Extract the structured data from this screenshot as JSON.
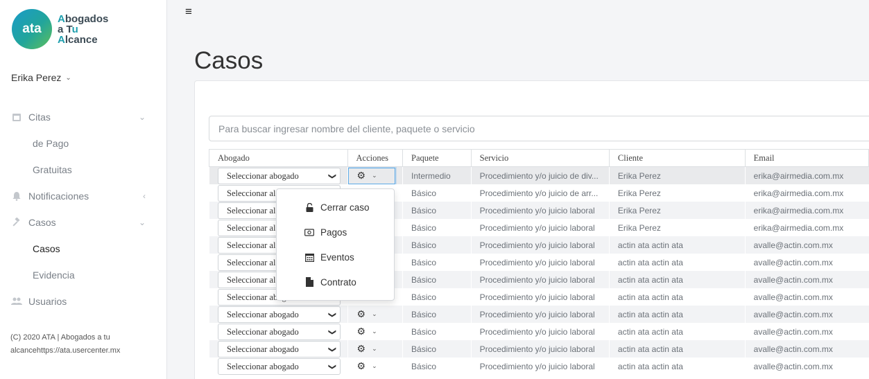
{
  "logo": {
    "mark": "ata",
    "line1_initial": "A",
    "line1_rest": "bogados",
    "line2_initial": "a T",
    "line2_rest": "u",
    "line3_initial": "A",
    "line3_rest": "lcance"
  },
  "user": {
    "name": "Erika Perez"
  },
  "nav": {
    "citas": "Citas",
    "de_pago": "de Pago",
    "gratuitas": "Gratuitas",
    "notificaciones": "Notificaciones",
    "casos": "Casos",
    "casos_sub": "Casos",
    "evidencia": "Evidencia",
    "usuarios": "Usuarios"
  },
  "footer": {
    "line1": "(C) 2020 ATA | Abogados a tu",
    "line2": "alcancehttps://ata.usercenter.mx"
  },
  "page": {
    "title": "Casos"
  },
  "search": {
    "placeholder": "Para buscar ingresar nombre del cliente, paquete o servicio"
  },
  "table": {
    "headers": {
      "abogado": "Abogado",
      "acciones": "Acciones",
      "paquete": "Paquete",
      "servicio": "Servicio",
      "cliente": "Cliente",
      "email": "Email"
    },
    "select_label": "Seleccionar abogado",
    "select_label_truncated": "Seleccionar al",
    "select_label_partial": "Seleccionar abogado",
    "rows": [
      {
        "paquete": "Intermedio",
        "servicio": "Procedimiento y/o juicio de div...",
        "cliente": "Erika Perez",
        "email": "erika@airmedia.com.mx"
      },
      {
        "paquete": "Básico",
        "servicio": "Procedimiento y/o juicio de arr...",
        "cliente": "Erika Perez",
        "email": "erika@airmedia.com.mx"
      },
      {
        "paquete": "Básico",
        "servicio": "Procedimiento y/o juicio laboral",
        "cliente": "Erika Perez",
        "email": "erika@airmedia.com.mx"
      },
      {
        "paquete": "Básico",
        "servicio": "Procedimiento y/o juicio laboral",
        "cliente": "Erika Perez",
        "email": "erika@airmedia.com.mx"
      },
      {
        "paquete": "Básico",
        "servicio": "Procedimiento y/o juicio laboral",
        "cliente": "actin ata actin ata",
        "email": "avalle@actin.com.mx"
      },
      {
        "paquete": "Básico",
        "servicio": "Procedimiento y/o juicio laboral",
        "cliente": "actin ata actin ata",
        "email": "avalle@actin.com.mx"
      },
      {
        "paquete": "Básico",
        "servicio": "Procedimiento y/o juicio laboral",
        "cliente": "actin ata actin ata",
        "email": "avalle@actin.com.mx"
      },
      {
        "paquete": "Básico",
        "servicio": "Procedimiento y/o juicio laboral",
        "cliente": "actin ata actin ata",
        "email": "avalle@actin.com.mx"
      },
      {
        "paquete": "Básico",
        "servicio": "Procedimiento y/o juicio laboral",
        "cliente": "actin ata actin ata",
        "email": "avalle@actin.com.mx"
      },
      {
        "paquete": "Básico",
        "servicio": "Procedimiento y/o juicio laboral",
        "cliente": "actin ata actin ata",
        "email": "avalle@actin.com.mx"
      },
      {
        "paquete": "Básico",
        "servicio": "Procedimiento y/o juicio laboral",
        "cliente": "actin ata actin ata",
        "email": "avalle@actin.com.mx"
      },
      {
        "paquete": "Básico",
        "servicio": "Procedimiento y/o juicio laboral",
        "cliente": "actin ata actin ata",
        "email": "avalle@actin.com.mx"
      }
    ]
  },
  "actions_menu": {
    "items": [
      {
        "label": "Cerrar caso",
        "icon": "unlock-icon"
      },
      {
        "label": "Pagos",
        "icon": "money-icon"
      },
      {
        "label": "Eventos",
        "icon": "calendar-icon"
      },
      {
        "label": "Contrato",
        "icon": "file-icon"
      }
    ]
  },
  "colors": {
    "brand_teal": "#1f9fae",
    "focus_blue": "#5aa9e6"
  }
}
